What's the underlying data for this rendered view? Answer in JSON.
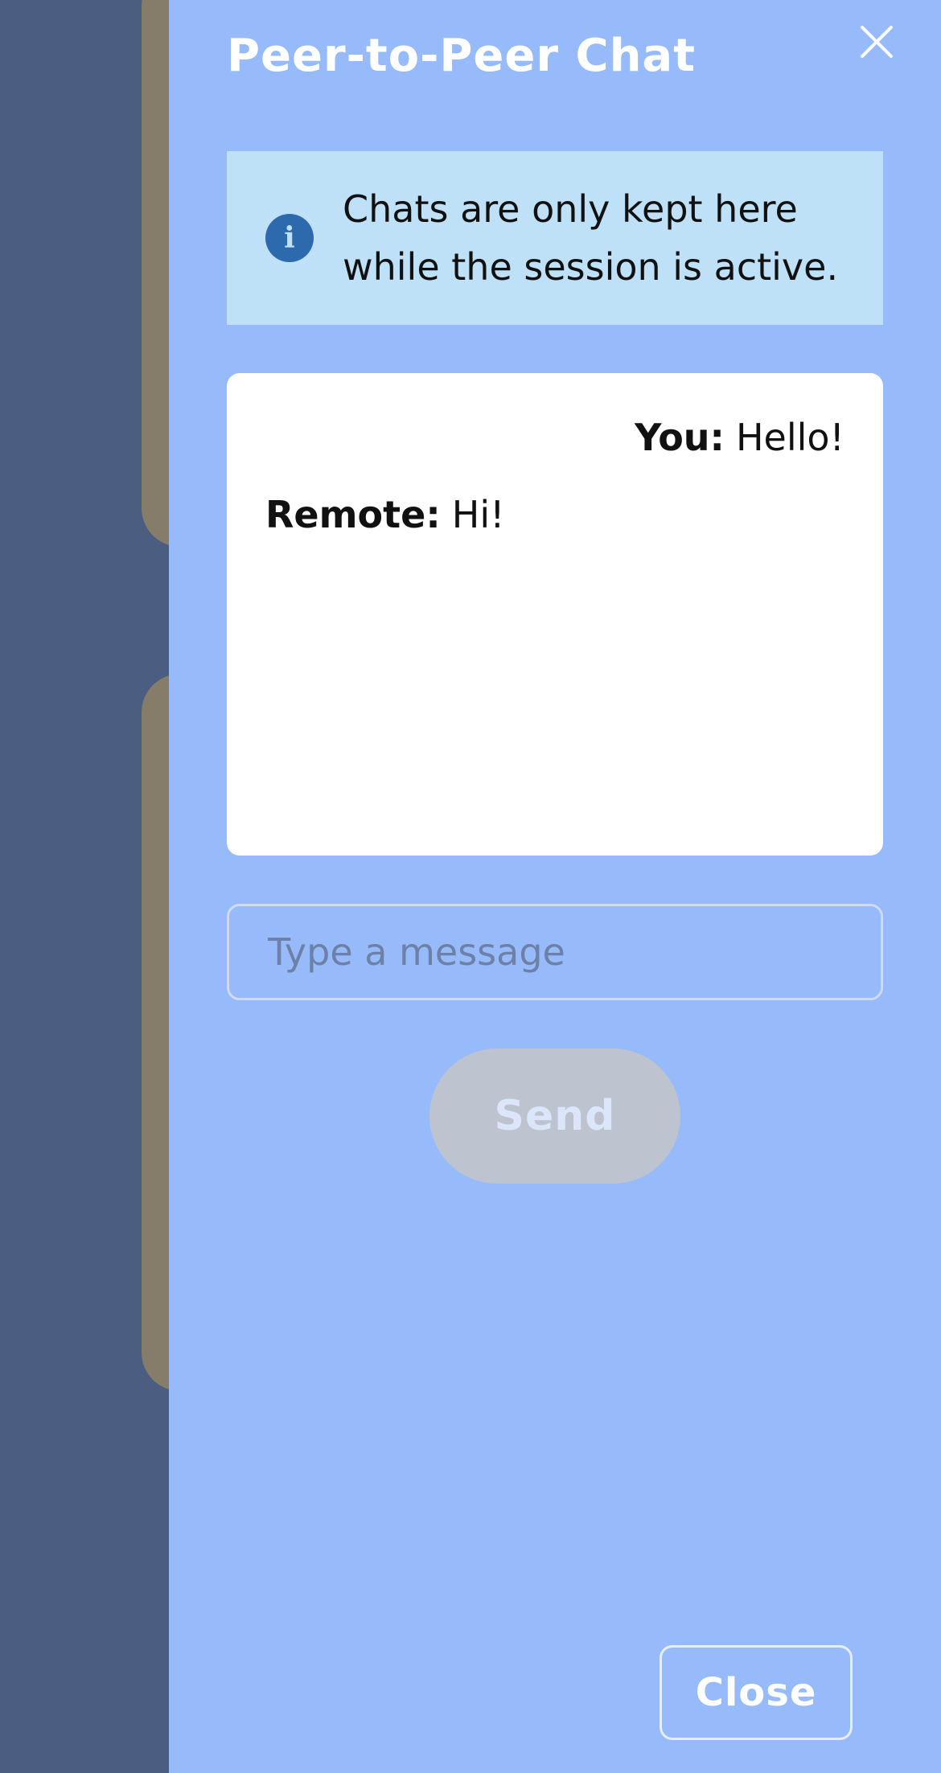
{
  "colors": {
    "backdrop": "#4b5d80",
    "drawer_bg": "#97bbfa",
    "info_bg": "#bee1f8",
    "info_icon": "#2d69ad",
    "send_disabled_bg": "#bec4cf"
  },
  "drawer": {
    "title": "Peer-to-Peer Chat",
    "close_icon": "close-x-icon"
  },
  "info": {
    "icon": "info-icon",
    "icon_glyph": "i",
    "text": "Chats are only kept here while the session is active."
  },
  "messages": [
    {
      "sender": "You:",
      "text": "Hello!",
      "mine": true
    },
    {
      "sender": "Remote:",
      "text": "Hi!",
      "mine": false
    }
  ],
  "composer": {
    "placeholder": "Type a message",
    "value": "",
    "send_label": "Send",
    "send_disabled": true
  },
  "footer": {
    "close_label": "Close"
  }
}
